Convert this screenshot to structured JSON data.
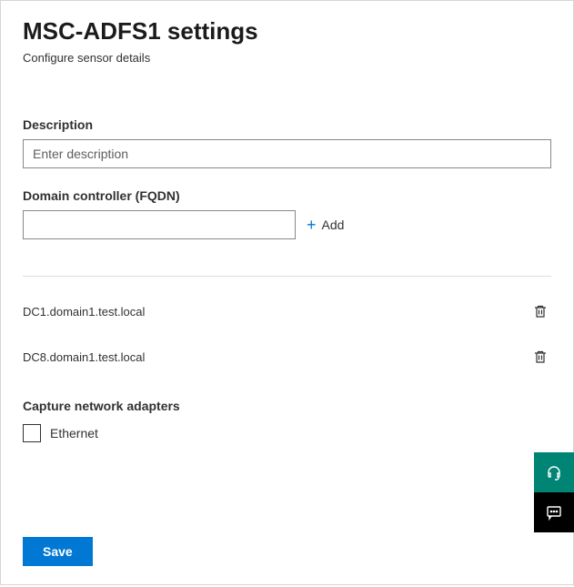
{
  "header": {
    "title": "MSC-ADFS1 settings",
    "subtitle": "Configure sensor details"
  },
  "description": {
    "label": "Description",
    "placeholder": "Enter description",
    "value": ""
  },
  "domainController": {
    "label": "Domain controller (FQDN)",
    "addLabel": "Add",
    "value": ""
  },
  "dcList": [
    {
      "name": "DC1.domain1.test.local"
    },
    {
      "name": "DC8.domain1.test.local"
    }
  ],
  "adapters": {
    "label": "Capture network adapters",
    "items": [
      {
        "label": "Ethernet",
        "checked": false
      }
    ]
  },
  "actions": {
    "save": "Save"
  }
}
